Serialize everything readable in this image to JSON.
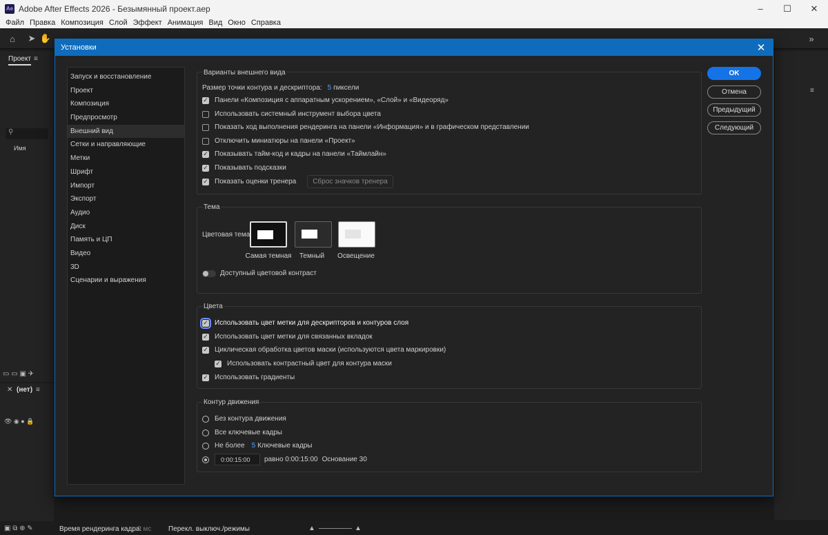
{
  "window": {
    "title": "Adobe After Effects 2026 - Безымянный проект.aep",
    "logo": "Ae",
    "minimize": "–",
    "maximize": "☐",
    "close": "✕"
  },
  "menu": [
    "Файл",
    "Правка",
    "Композиция",
    "Слой",
    "Эффект",
    "Анимация",
    "Вид",
    "Окно",
    "Справка"
  ],
  "project_panel": {
    "tab": "Проект",
    "column_name": "Имя",
    "comp_tab": "(нет)"
  },
  "status": {
    "render_label": "Время рендеринга кадра:",
    "render_value": "0 мс",
    "toggle_modes": "Перекл. выключ./режимы"
  },
  "dialog": {
    "title": "Установки",
    "close": "✕",
    "categories": [
      "Запуск и восстановление",
      "Проект",
      "Композиция",
      "Предпросмотр",
      "Внешний вид",
      "Сетки и направляющие",
      "Метки",
      "Шрифт",
      "Импорт",
      "Экспорт",
      "Аудио",
      "Диск",
      "Память и ЦП",
      "Видео",
      "3D",
      "Сценарии и выражения"
    ],
    "selected_category": "Внешний вид",
    "buttons": {
      "ok": "OK",
      "cancel": "Отмена",
      "previous": "Предыдущий",
      "next": "Следующий"
    },
    "appearance": {
      "title": "Варианты внешнего вида",
      "handle_size_label": "Размер точки контура и дескриптора:",
      "handle_size_value": "5",
      "handle_size_unit": "пиксели",
      "options": [
        {
          "label": "Панели «Композиция с аппаратным ускорением», «Слой» и «Видеоряд»",
          "checked": true
        },
        {
          "label": "Использовать системный инструмент выбора цвета",
          "checked": false
        },
        {
          "label": "Показать ход выполнения рендеринга на панели «Информация» и в графическом представлении",
          "checked": false
        },
        {
          "label": "Отключить миниатюры на панели «Проект»",
          "checked": false
        },
        {
          "label": "Показывать тайм-код и кадры на панели «Таймлайн»",
          "checked": true
        },
        {
          "label": "Показывать подсказки",
          "checked": true
        },
        {
          "label": "Показать оценки тренера",
          "checked": true
        }
      ],
      "reset_coach_button": "Сброс значков тренера"
    },
    "theme": {
      "title": "Тема",
      "color_theme_label": "Цветовая тема",
      "themes": [
        {
          "label": "Самая темная",
          "selected": true
        },
        {
          "label": "Темный",
          "selected": false
        },
        {
          "label": "Освещение",
          "selected": false
        }
      ],
      "contrast_label": "Доступный цветовой контраст",
      "contrast_on": false
    },
    "colors": {
      "title": "Цвета",
      "options": [
        {
          "label": "Использовать цвет метки для дескрипторов и контуров слоя",
          "checked": true
        },
        {
          "label": "Использовать цвет метки для связанных вкладок",
          "checked": true
        },
        {
          "label": "Циклическая обработка цветов маски (используются цвета маркировки)",
          "checked": true
        },
        {
          "label": "Использовать контрастный цвет для контура маски",
          "checked": true
        },
        {
          "label": "Использовать градиенты",
          "checked": true
        }
      ]
    },
    "motion_path": {
      "title": "Контур движения",
      "options": [
        {
          "label": "Без контура движения",
          "selected": false
        },
        {
          "label": "Все ключевые кадры",
          "selected": false
        },
        {
          "label": "Не более",
          "selected": false
        },
        {
          "label": "",
          "selected": true
        }
      ],
      "max_keyframes_value": "5",
      "max_keyframes_label": "Ключевые кадры",
      "timecode_value": "0:00:15:00",
      "equals_text": "равно 0:00:15:00",
      "base_text": "Основание 30"
    }
  },
  "colors": {
    "accent": "#0f6cbd",
    "ok_button": "#1473e6",
    "link_value": "#4fa3ff"
  }
}
